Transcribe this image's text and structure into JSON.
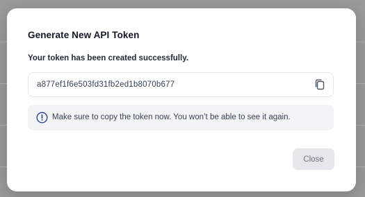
{
  "dialog": {
    "title": "Generate New API Token",
    "success_message": "Your token has been created successfully.",
    "token_value": "a877ef1f6e503fd31fb2ed1b8070b677",
    "notice_text": "Make sure to copy the token now. You won’t be able to see it again.",
    "close_label": "Close"
  },
  "icons": {
    "copy": "copy-icon",
    "info": "info-circle-icon"
  },
  "colors": {
    "info_accent": "#1e3a8a",
    "close_button_bg": "#e5e7eb",
    "close_button_text": "#6b7280"
  }
}
